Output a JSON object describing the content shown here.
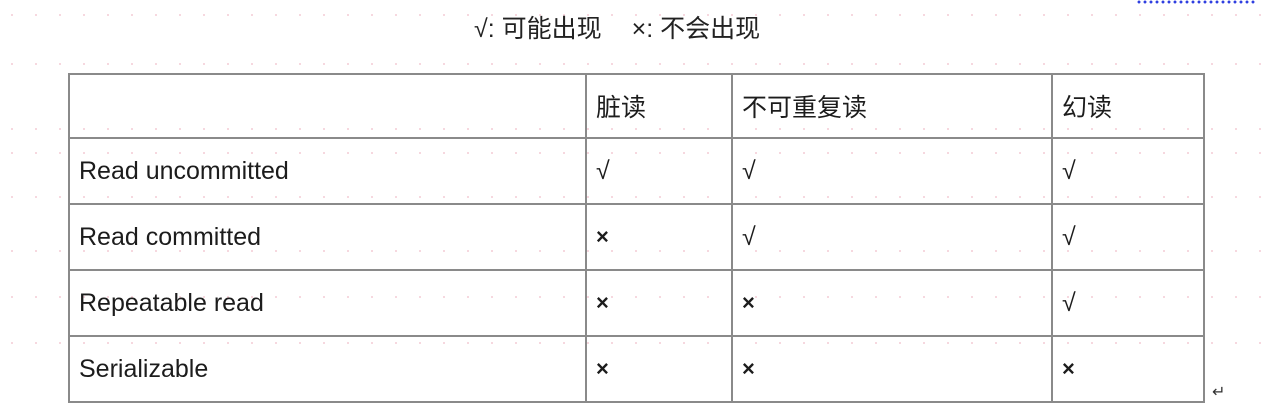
{
  "legend": {
    "possible": "√: 可能出现",
    "impossible": "×: 不会出现"
  },
  "table": {
    "headers": [
      "",
      "脏读",
      "不可重复读",
      "幻读"
    ],
    "rows": [
      {
        "level": "Read uncommitted",
        "dirty_read": "√",
        "non_repeatable_read": "√",
        "phantom_read": "√"
      },
      {
        "level": "Read committed",
        "dirty_read": "×",
        "non_repeatable_read": "√",
        "phantom_read": "√"
      },
      {
        "level": "Repeatable read",
        "dirty_read": "×",
        "non_repeatable_read": "×",
        "phantom_read": "√"
      },
      {
        "level": "Serializable",
        "dirty_read": "×",
        "non_repeatable_read": "×",
        "phantom_read": "×"
      }
    ]
  },
  "return_mark": "↵"
}
